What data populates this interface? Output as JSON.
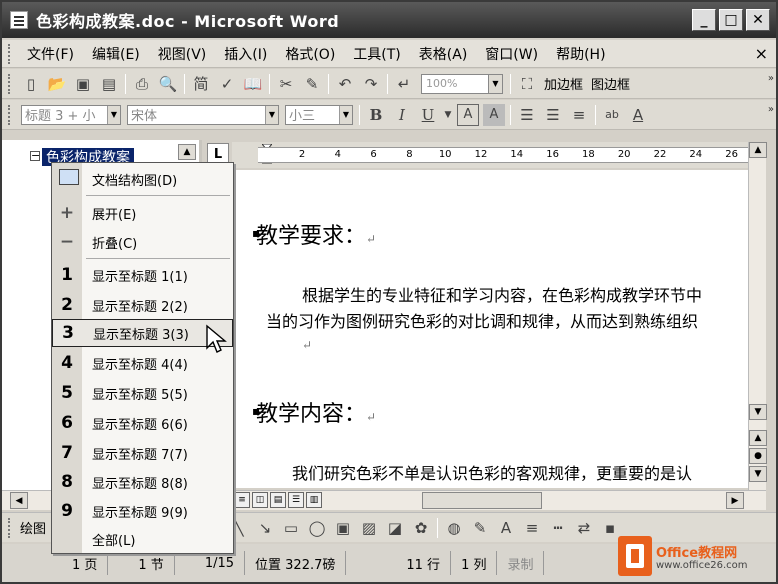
{
  "window": {
    "title": "色彩构成教案.doc - Microsoft Word"
  },
  "menubar": {
    "items": [
      "文件(F)",
      "编辑(E)",
      "视图(V)",
      "插入(I)",
      "格式(O)",
      "工具(T)",
      "表格(A)",
      "窗口(W)",
      "帮助(H)"
    ],
    "close": "×"
  },
  "toolbar": {
    "zoom": "100%",
    "add_border": "加边框",
    "figure_border": "图边框"
  },
  "format_toolbar": {
    "style": "标题 3 + 小",
    "font": "宋体",
    "size": "小三"
  },
  "docmap": {
    "selected_heading": "色彩构成教案"
  },
  "ruler": {
    "ticks": [
      "2",
      "4",
      "6",
      "8",
      "10",
      "12",
      "14",
      "16",
      "18",
      "20",
      "22",
      "24",
      "26"
    ]
  },
  "document": {
    "heading1": "教学要求：",
    "para1_line1": "根据学生的专业特征和学习内容，在色彩构成教学环节中",
    "para1_line2": "当的习作为图例研究色彩的对比调和规律，从而达到熟练组织",
    "heading2": "教学内容：",
    "para2_line1": "我们研究色彩不单是认识色彩的客观规律，更重要的是认",
    "para_mark": "↵"
  },
  "context_menu": {
    "items": [
      {
        "icon": "docmap",
        "label": "文档结构图(D)"
      },
      {
        "icon": "+",
        "label": "展开(E)"
      },
      {
        "icon": "−",
        "label": "折叠(C)"
      },
      {
        "icon": "1",
        "label": "显示至标题 1(1)"
      },
      {
        "icon": "2",
        "label": "显示至标题 2(2)"
      },
      {
        "icon": "3",
        "label": "显示至标题 3(3)"
      },
      {
        "icon": "4",
        "label": "显示至标题 4(4)"
      },
      {
        "icon": "5",
        "label": "显示至标题 5(5)"
      },
      {
        "icon": "6",
        "label": "显示至标题 6(6)"
      },
      {
        "icon": "7",
        "label": "显示至标题 7(7)"
      },
      {
        "icon": "8",
        "label": "显示至标题 8(8)"
      },
      {
        "icon": "9",
        "label": "显示至标题 9(9)"
      },
      {
        "icon": "",
        "label": "全部(L)"
      }
    ],
    "highlighted_index": 5
  },
  "drawbar": {
    "label": "绘图"
  },
  "statusbar": {
    "page": "1 页",
    "section": "1 节",
    "page_of": "1/15",
    "position": "位置 322.7磅",
    "line": "11 行",
    "column": "1 列",
    "record": "录制"
  },
  "watermark": {
    "brand": "Office教程网",
    "url": "www.office26.com"
  },
  "colors": {
    "title_bar": "#2b2b2b",
    "docmap_selected": "#0a246a",
    "watermark_orange": "#e8601c"
  }
}
